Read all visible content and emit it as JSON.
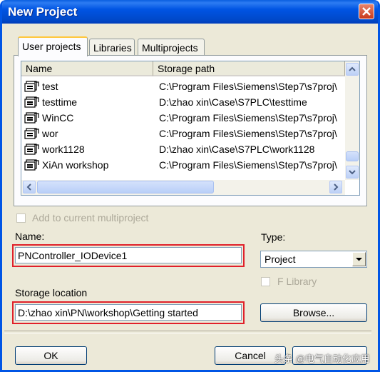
{
  "window": {
    "title": "New Project"
  },
  "tabs": [
    {
      "label": "User projects",
      "active": true
    },
    {
      "label": "Libraries",
      "active": false
    },
    {
      "label": "Multiprojects",
      "active": false
    }
  ],
  "list": {
    "columns": [
      "Name",
      "Storage path"
    ],
    "rows": [
      {
        "name": "test",
        "path": "C:\\Program Files\\Siemens\\Step7\\s7proj\\"
      },
      {
        "name": "testtime",
        "path": "D:\\zhao xin\\Case\\S7PLC\\testtime"
      },
      {
        "name": "WinCC",
        "path": "C:\\Program Files\\Siemens\\Step7\\s7proj\\"
      },
      {
        "name": "wor",
        "path": "C:\\Program Files\\Siemens\\Step7\\s7proj\\"
      },
      {
        "name": "work1128",
        "path": "D:\\zhao xin\\Case\\S7PLC\\work1128"
      },
      {
        "name": "XiAn workshop",
        "path": "C:\\Program Files\\Siemens\\Step7\\s7proj\\"
      }
    ]
  },
  "add_to_multiproject": {
    "label": "Add to current multiproject",
    "checked": false,
    "enabled": false
  },
  "name": {
    "label": "Name:",
    "value": "PNController_IODevice1"
  },
  "type": {
    "label": "Type:",
    "value": "Project"
  },
  "f_library": {
    "label": "F Library",
    "checked": false,
    "enabled": false
  },
  "storage": {
    "label": "Storage location",
    "value": "D:\\zhao xin\\PN\\workshop\\Getting started"
  },
  "buttons": {
    "browse": "Browse...",
    "ok": "OK",
    "cancel": "Cancel"
  },
  "watermark": "头条 @电气自动化应用",
  "colors": {
    "titlebar": "#0054e3",
    "highlight_border": "#e0202a",
    "dialog_bg": "#ece9d8"
  }
}
